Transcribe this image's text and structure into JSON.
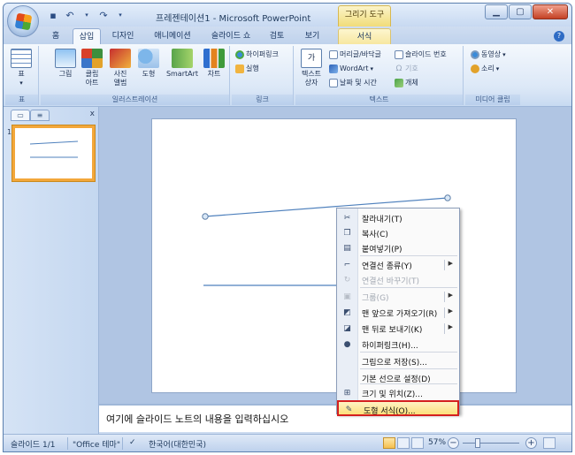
{
  "app": {
    "title": "프레젠테이션1 - Microsoft PowerPoint",
    "context_title": "그리기 도구"
  },
  "tabs": [
    {
      "label": "홈"
    },
    {
      "label": "삽입"
    },
    {
      "label": "디자인"
    },
    {
      "label": "애니메이션"
    },
    {
      "label": "슬라이드 쇼"
    },
    {
      "label": "검토"
    },
    {
      "label": "보기"
    },
    {
      "label": "서식"
    }
  ],
  "ribbon": {
    "groups": {
      "table": "표",
      "illustrations": "일러스트레이션",
      "links": "링크",
      "text": "텍스트",
      "media": "미디어 클립"
    },
    "table_btn": "표",
    "picture_btn": "그림",
    "clipart_btn": "클립\n아트",
    "album_btn": "사진\n앨범",
    "shapes_btn": "도형",
    "smartart_btn": "SmartArt",
    "chart_btn": "차트",
    "hyperlink_btn": "하이퍼링크",
    "action_btn": "실행",
    "textbox_btn": "텍스트\n상자",
    "header_btn": "머리글/바닥글",
    "wordart_btn": "WordArt",
    "datetime_btn": "날짜 및 시간",
    "slidenum_btn": "슬라이드 번호",
    "symbol_btn": "기호",
    "object_btn": "개체",
    "movie_btn": "동영상",
    "sound_btn": "소리"
  },
  "left_panel": {
    "slide_number": "1"
  },
  "notes": {
    "placeholder": "여기에 슬라이드 노트의 내용을 입력하십시오"
  },
  "status": {
    "slide": "슬라이드 1/1",
    "theme": "\"Office 테마\"",
    "language": "한국어(대한민국)",
    "zoom": "57%",
    "zoom_level_percent": 57
  },
  "context_menu": {
    "items": [
      {
        "label": "잘라내기(T)",
        "icon": "scissors-icon",
        "enabled": true
      },
      {
        "label": "복사(C)",
        "icon": "copy-icon",
        "enabled": true
      },
      {
        "label": "붙여넣기(P)",
        "icon": "paste-icon",
        "enabled": true
      },
      {
        "label": "연결선 종류(Y)",
        "icon": "connector-type-icon",
        "enabled": true,
        "submenu": true
      },
      {
        "label": "연결선 바꾸기(T)",
        "icon": "reroute-connector-icon",
        "enabled": false
      },
      {
        "label": "그룹(G)",
        "icon": "group-icon",
        "enabled": false,
        "submenu": true
      },
      {
        "label": "맨 앞으로 가져오기(R)",
        "icon": "bring-to-front-icon",
        "enabled": true,
        "submenu": true
      },
      {
        "label": "맨 뒤로 보내기(K)",
        "icon": "send-to-back-icon",
        "enabled": true,
        "submenu": true
      },
      {
        "label": "하이퍼링크(H)...",
        "icon": "hyperlink-icon",
        "enabled": true
      },
      {
        "label": "그림으로 저장(S)...",
        "icon": "",
        "enabled": true
      },
      {
        "label": "기본 선으로 설정(D)",
        "icon": "",
        "enabled": true
      },
      {
        "label": "크기 및 위치(Z)...",
        "icon": "size-position-icon",
        "enabled": true
      },
      {
        "label": "도형 서식(O)...",
        "icon": "format-shape-icon",
        "enabled": true,
        "highlighted": true
      }
    ]
  },
  "colors": {
    "highlight_border": "#d41f1f",
    "thumbnail_selection": "#f3a73a",
    "ribbon_context_tab": "#f1dc79"
  }
}
